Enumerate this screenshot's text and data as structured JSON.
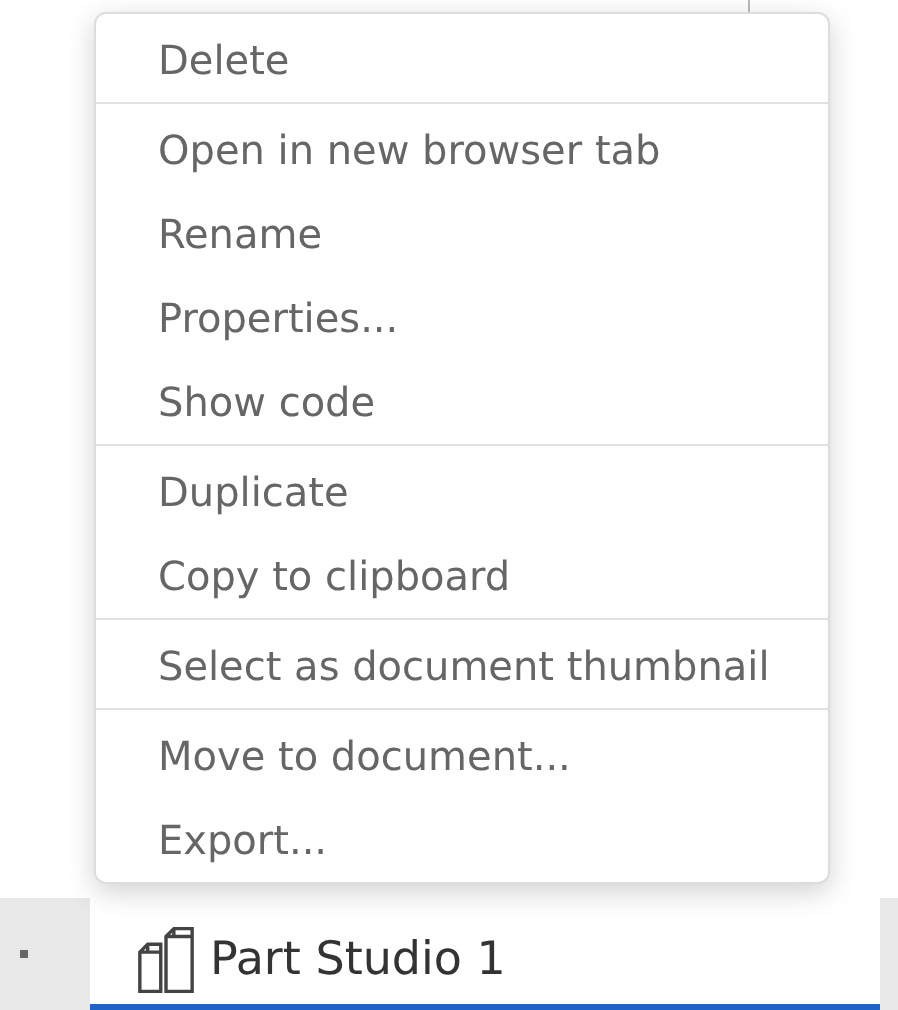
{
  "context_menu": {
    "groups": [
      {
        "items": [
          "Delete"
        ]
      },
      {
        "items": [
          "Open in new browser tab",
          "Rename",
          "Properties...",
          "Show code"
        ]
      },
      {
        "items": [
          "Duplicate",
          "Copy to clipboard"
        ]
      },
      {
        "items": [
          "Select as document thumbnail"
        ]
      },
      {
        "items": [
          "Move to document...",
          "Export..."
        ]
      }
    ]
  },
  "tabs": [
    {
      "label": "Part Studio 1",
      "selected": true
    }
  ]
}
